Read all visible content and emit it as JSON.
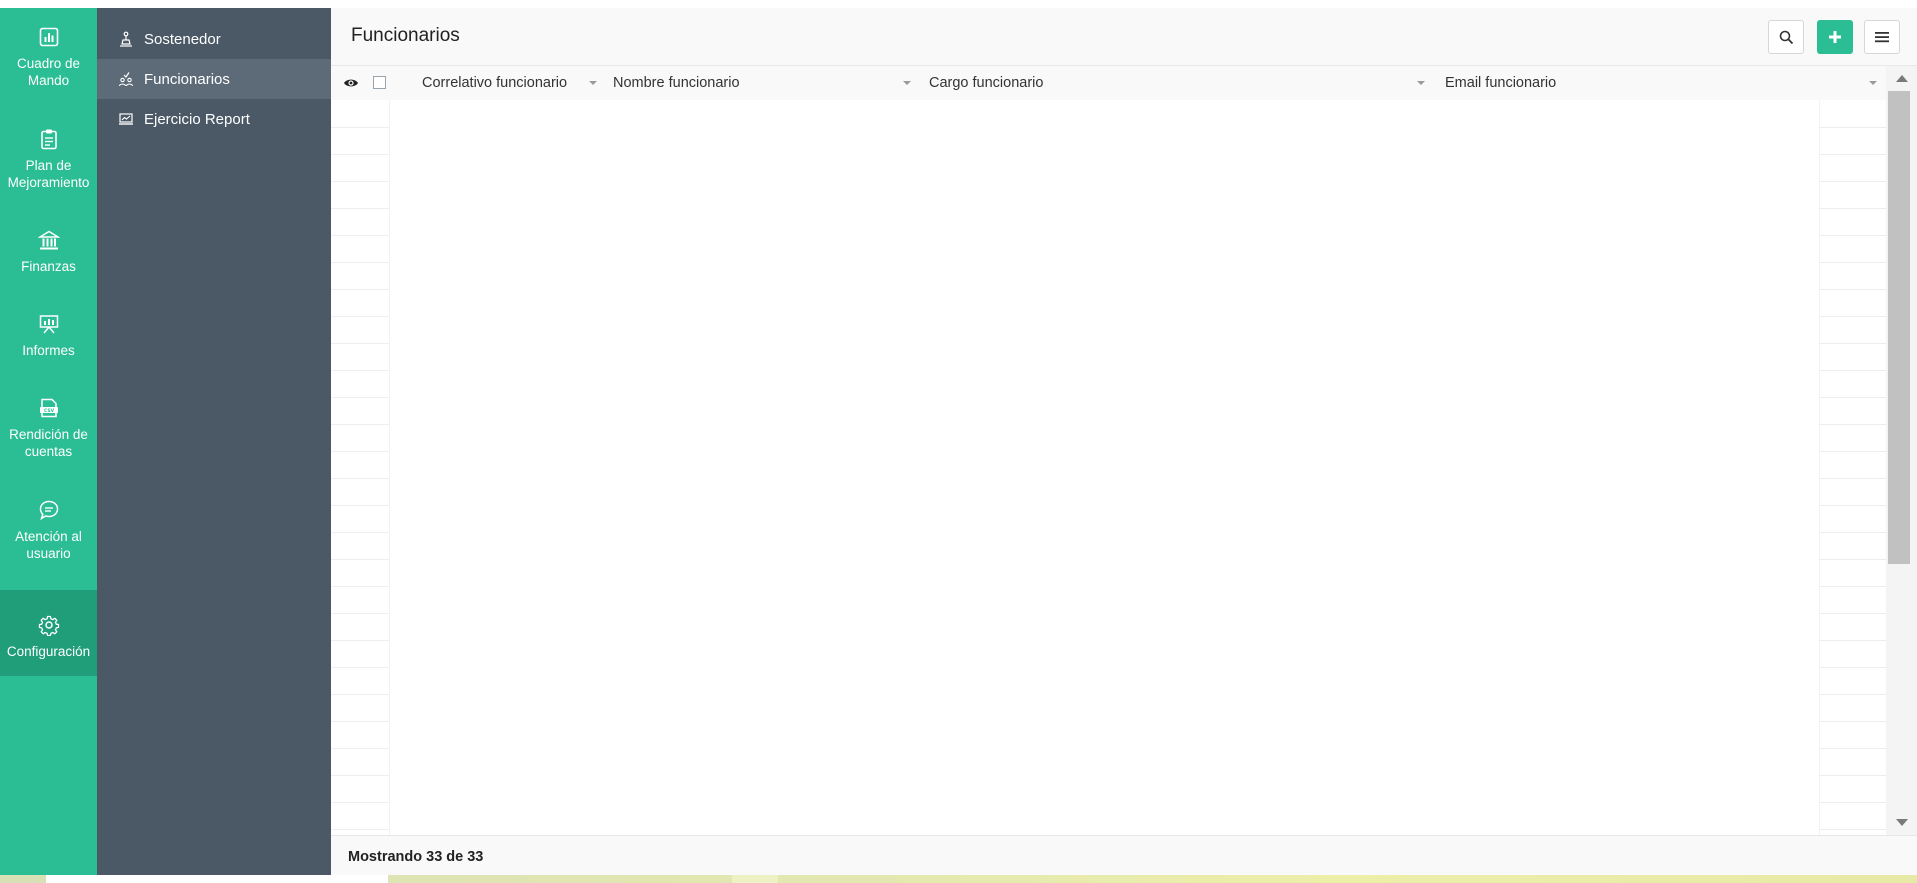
{
  "main_nav": {
    "items": [
      {
        "label": "Cuadro de Mando",
        "icon": "bar-chart-icon"
      },
      {
        "label": "Plan de Mejoramiento",
        "icon": "clipboard-icon"
      },
      {
        "label": "Finanzas",
        "icon": "bank-icon"
      },
      {
        "label": "Informes",
        "icon": "presentation-board-icon"
      },
      {
        "label": "Rendición de cuentas",
        "icon": "csv-file-icon"
      },
      {
        "label": "Atención al usuario",
        "icon": "chat-bubble-icon"
      },
      {
        "label": "Configuración",
        "icon": "gear-icon",
        "active": true
      }
    ],
    "color": "#2bbd93",
    "active_color": "#1f9e79"
  },
  "sub_nav": {
    "items": [
      {
        "label": "Sostenedor",
        "icon": "sostenedor-icon"
      },
      {
        "label": "Funcionarios",
        "icon": "people-icon",
        "active": true
      },
      {
        "label": "Ejercicio Report",
        "icon": "monitor-chart-icon"
      }
    ],
    "color": "#4b5866"
  },
  "header": {
    "title": "Funcionarios",
    "buttons": [
      {
        "name": "search",
        "icon": "search-icon"
      },
      {
        "name": "add",
        "icon": "plus-icon"
      },
      {
        "name": "menu",
        "icon": "hamburger-menu-icon"
      }
    ]
  },
  "table": {
    "columns": [
      {
        "label": "Correlativo funcionario"
      },
      {
        "label": "Nombre funcionario"
      },
      {
        "label": "Cargo funcionario"
      },
      {
        "label": "Email funcionario"
      }
    ],
    "visibility_icon": "eye-icon"
  },
  "footer": {
    "status": "Mostrando 33 de 33"
  }
}
